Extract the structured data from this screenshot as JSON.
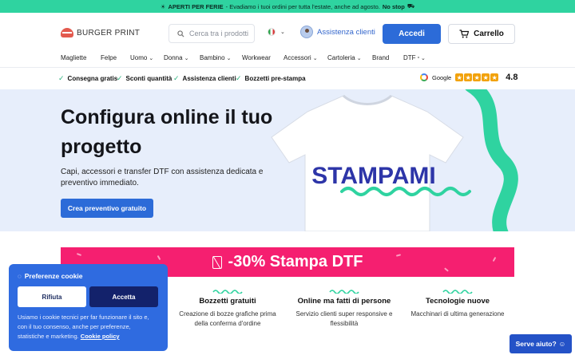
{
  "promo": {
    "text_bold": "APERTI PER FERIE",
    "text": " - Evadiamo i tuoi ordini per tutta l'estate, anche ad agosto.",
    "text_end": "No stop"
  },
  "header": {
    "logo_text": "BURGER PRINT",
    "search_placeholder": "Cerca tra i prodotti",
    "assist_label": "Assistenza clienti",
    "login_label": "Accedi",
    "cart_label": "Carrello"
  },
  "nav": {
    "items": [
      {
        "label": "Magliette",
        "dropdown": false
      },
      {
        "label": "Felpe",
        "dropdown": false
      },
      {
        "label": "Uomo",
        "dropdown": true
      },
      {
        "label": "Donna",
        "dropdown": true
      },
      {
        "label": "Bambino",
        "dropdown": true
      },
      {
        "label": "Workwear",
        "dropdown": false
      },
      {
        "label": "Accessori",
        "dropdown": true
      },
      {
        "label": "Cartoleria",
        "dropdown": true
      },
      {
        "label": "Brand",
        "dropdown": false
      },
      {
        "label": "DTF",
        "dropdown": true
      }
    ]
  },
  "usp": {
    "items": [
      "Consegna gratis",
      "Sconti quantità",
      "Assistenza clienti",
      "Bozzetti pre-stampa"
    ],
    "rating_source": "Google",
    "rating_score": "4.8",
    "rating_stars": 5
  },
  "hero": {
    "title": "Configura online il tuo progetto",
    "subtitle": "Capi, accessori e transfer DTF con assistenza dedicata e preventivo immediato.",
    "cta": "Crea preventivo gratuito",
    "shirt_text": "STAMPAMI"
  },
  "banner": {
    "text": "-30% Stampa DTF"
  },
  "features": [
    {
      "title": "Bozzetti gratuiti",
      "desc": "Creazione di bozze grafiche prima della conferma d'ordine"
    },
    {
      "title": "Online ma fatti di persone",
      "desc": "Servizio clienti super responsive e flessibilità"
    },
    {
      "title": "Tecnologie nuove",
      "desc": "Macchinari di ultima generazione"
    }
  ],
  "cookie": {
    "title": "Preferenze cookie",
    "reject": "Rifiuta",
    "accept": "Accetta",
    "text": "Usiamo i cookie tecnici per far funzionare il sito e, con il tuo consenso, anche per preferenze, statistiche e marketing.",
    "link": "Cookie policy"
  },
  "help": {
    "label": "Serve aiuto?"
  },
  "colors": {
    "promo_bg": "#2fd3a0",
    "primary": "#2c6bd8",
    "hero_bg": "#e7eefb",
    "banner_bg": "#f51f70",
    "accent_green": "#2fd3a0",
    "cookie_bg": "#2f6be0",
    "star": "#f2a20c"
  }
}
